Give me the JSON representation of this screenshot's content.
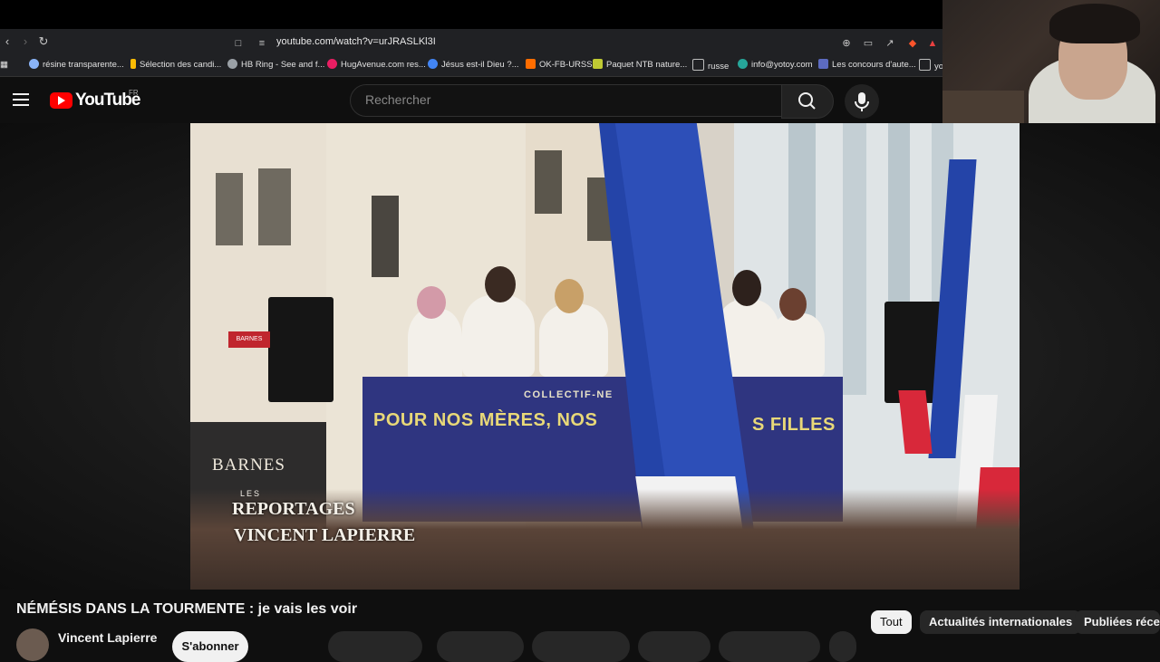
{
  "browser": {
    "url": "youtube.com/watch?v=urJRASLKl3I",
    "bookmarks": [
      {
        "label": "résine transparente...",
        "color": "#8ab4f8"
      },
      {
        "label": "Sélection des candi...",
        "color": "#fbbc04"
      },
      {
        "label": "HB Ring - See and f...",
        "color": "#9aa0a6"
      },
      {
        "label": "HugAvenue.com res...",
        "color": "#e91e63"
      },
      {
        "label": "Jésus est-il Dieu ?...",
        "color": "#4285f4"
      },
      {
        "label": "OK-FB-URSS",
        "color": "#ff6d00"
      },
      {
        "label": "Paquet NTB nature...",
        "color": "#c0ca33"
      },
      {
        "label": "russe",
        "color": "#bdbdbd"
      },
      {
        "label": "info@yotoy.com",
        "color": "#26a69a"
      },
      {
        "label": "Les concours d'aute...",
        "color": "#5c6bc0"
      },
      {
        "label": "yo",
        "color": "#bdbdbd"
      }
    ]
  },
  "header": {
    "logo_text": "YouTube",
    "region": "FR",
    "search_placeholder": "Rechercher"
  },
  "video": {
    "banner_top": "COLLECTIF-NE",
    "banner_main": "POUR NOS MÈRES, NOS",
    "banner_right": "S FILLES",
    "shop_sign": "BARNES",
    "shop_sign_small": "BARNES",
    "watermark_top": "LES",
    "watermark_mid": "REPORTAGES",
    "watermark_bot": "VINCENT LAPIERRE"
  },
  "below": {
    "title": "NÉMÉSIS DANS LA TOURMENTE : je vais les voir",
    "channel_name": "Vincent Lapierre",
    "subscribe_label": "S'abonner"
  },
  "chips": [
    {
      "label": "Tout",
      "active": true
    },
    {
      "label": "Actualités internationales",
      "active": false
    },
    {
      "label": "Publiées réce",
      "active": false
    }
  ],
  "colors": {
    "yt_red": "#ff0000",
    "page_bg": "#0f0f0f",
    "banner_blue": "#2f3580",
    "flag_blue": "#2444a8",
    "flag_red": "#d8283a"
  }
}
